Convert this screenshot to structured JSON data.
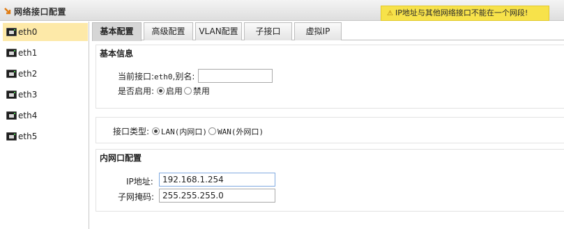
{
  "header": {
    "title": "网络接口配置",
    "warning": "IP地址与其他网络接口不能在一个网段!"
  },
  "sidebar": {
    "items": [
      {
        "label": "eth0",
        "active": true
      },
      {
        "label": "eth1",
        "active": false
      },
      {
        "label": "eth2",
        "active": false
      },
      {
        "label": "eth3",
        "active": false
      },
      {
        "label": "eth4",
        "active": false
      },
      {
        "label": "eth5",
        "active": false
      }
    ]
  },
  "tabs": [
    {
      "label": "基本配置",
      "active": true
    },
    {
      "label": "高级配置",
      "active": false
    },
    {
      "label": "VLAN配置",
      "active": false
    },
    {
      "label": "子接口",
      "active": false
    },
    {
      "label": "虚拟IP",
      "active": false
    }
  ],
  "basic_info": {
    "section_title": "基本信息",
    "current_iface_label": "当前接口:",
    "current_iface_value": "eth0",
    "alias_label": ",别名:",
    "alias_value": "",
    "enable_label": "是否启用:",
    "enable_on": "启用",
    "enable_off": "禁用",
    "enabled": true
  },
  "iface_type": {
    "label": "接口类型:",
    "lan": "LAN(内网口)",
    "wan": "WAN(外网口)",
    "selected": "LAN"
  },
  "lan_config": {
    "section_title": "内网口配置",
    "ip_label": "IP地址:",
    "ip_value": "192.168.1.254",
    "mask_label": "子网掩码:",
    "mask_value": "255.255.255.0"
  },
  "colors": {
    "active_item_bg": "#fde9a8",
    "warning_bg": "#f7e24a",
    "title_icon": "#e07a10"
  },
  "icons": [
    "arrow-down-right-icon",
    "warning-icon",
    "network-port-icon"
  ]
}
